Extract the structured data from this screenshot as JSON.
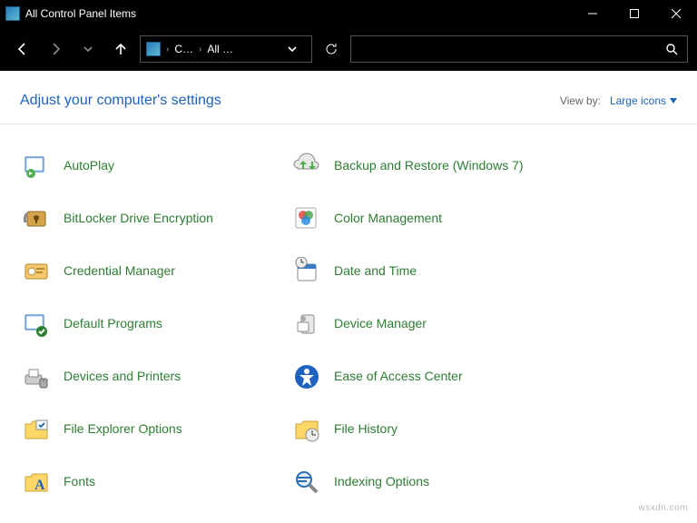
{
  "window": {
    "title": "All Control Panel Items"
  },
  "breadcrumb": {
    "crumb1": "C…",
    "crumb2": "All …"
  },
  "header": {
    "title": "Adjust your computer's settings",
    "viewby_label": "View by:",
    "viewby_value": "Large icons"
  },
  "items": [
    {
      "label": "AutoPlay",
      "icon": "autoplay-icon"
    },
    {
      "label": "Backup and Restore (Windows 7)",
      "icon": "backup-restore-icon"
    },
    {
      "label": "BitLocker Drive Encryption",
      "icon": "bitlocker-icon"
    },
    {
      "label": "Color Management",
      "icon": "color-management-icon"
    },
    {
      "label": "Credential Manager",
      "icon": "credential-manager-icon"
    },
    {
      "label": "Date and Time",
      "icon": "date-time-icon"
    },
    {
      "label": "Default Programs",
      "icon": "default-programs-icon"
    },
    {
      "label": "Device Manager",
      "icon": "device-manager-icon"
    },
    {
      "label": "Devices and Printers",
      "icon": "devices-printers-icon"
    },
    {
      "label": "Ease of Access Center",
      "icon": "ease-of-access-icon"
    },
    {
      "label": "File Explorer Options",
      "icon": "file-explorer-options-icon"
    },
    {
      "label": "File History",
      "icon": "file-history-icon"
    },
    {
      "label": "Fonts",
      "icon": "fonts-icon"
    },
    {
      "label": "Indexing Options",
      "icon": "indexing-options-icon"
    }
  ],
  "watermark": "wsxdn.com"
}
